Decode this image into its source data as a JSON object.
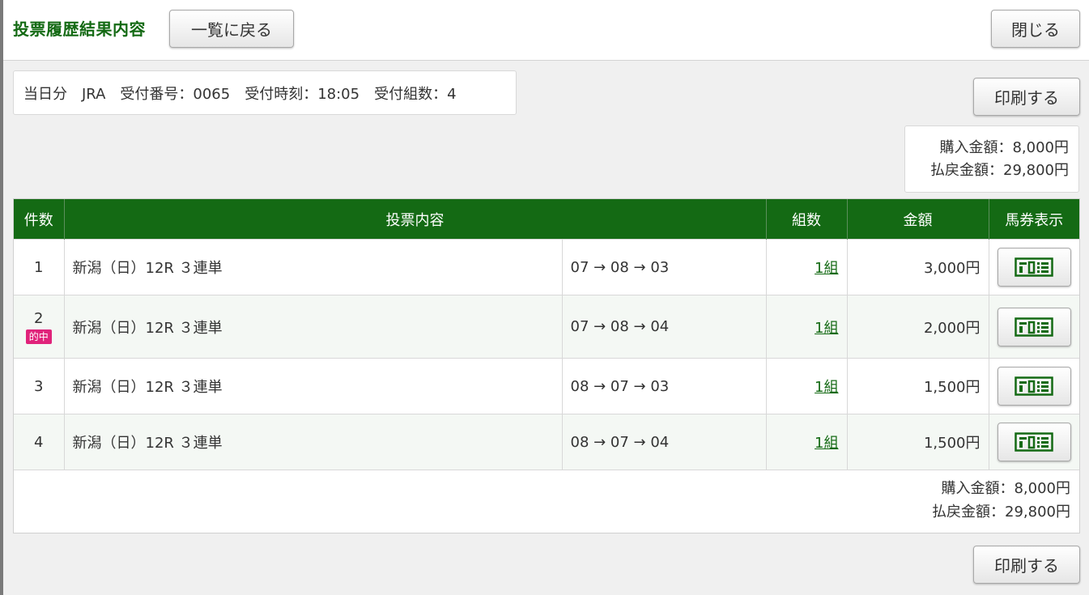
{
  "header": {
    "title": "投票履歴結果内容",
    "back_label": "一覧に戻る",
    "close_label": "閉じる"
  },
  "info": {
    "text": "当日分　JRA　受付番号：0065　受付時刻：18:05　受付組数：4"
  },
  "print_label": "印刷する",
  "summary": {
    "purchase": "購入金額：8,000円",
    "refund": "払戻金額：29,800円"
  },
  "table": {
    "headers": {
      "count": "件数",
      "content": "投票内容",
      "kumi": "組数",
      "amount": "金額",
      "ticket": "馬券表示"
    },
    "rows": [
      {
        "no": "1",
        "race": "新潟（日）12R ３連単",
        "combo": "07 → 08 → 03",
        "kumi": "1組",
        "amount": "3,000円"
      },
      {
        "no": "2",
        "hit": "的中",
        "race": "新潟（日）12R ３連単",
        "combo": "07 → 08 → 04",
        "kumi": "1組",
        "amount": "2,000円"
      },
      {
        "no": "3",
        "race": "新潟（日）12R ３連単",
        "combo": "08 → 07 → 03",
        "kumi": "1組",
        "amount": "1,500円"
      },
      {
        "no": "4",
        "race": "新潟（日）12R ３連単",
        "combo": "08 → 07 → 04",
        "kumi": "1組",
        "amount": "1,500円"
      }
    ]
  },
  "colors": {
    "brand_green": "#146a14",
    "hit_pink": "#e0237a"
  }
}
